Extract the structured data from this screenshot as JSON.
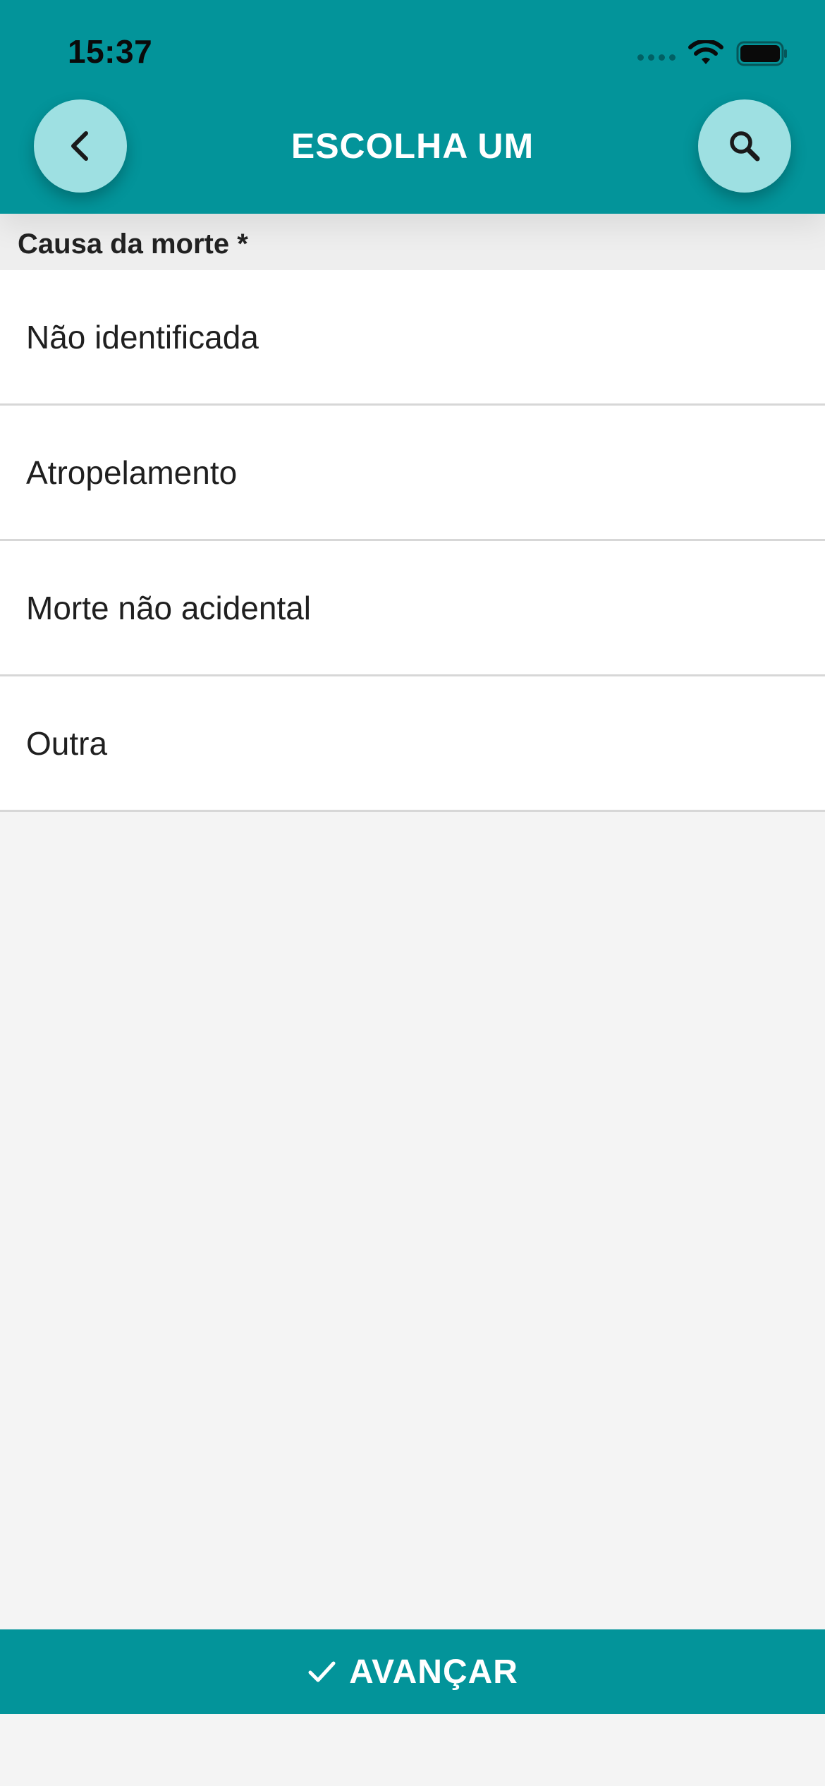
{
  "status_bar": {
    "time": "15:37",
    "icons": [
      "cellular-signal-icon",
      "wifi-icon",
      "battery-icon"
    ]
  },
  "header": {
    "title": "ESCOLHA UM",
    "back_icon": "chevron-left-icon",
    "search_icon": "search-icon"
  },
  "section": {
    "label": "Causa da morte *"
  },
  "options": [
    {
      "label": "Não identificada"
    },
    {
      "label": "Atropelamento"
    },
    {
      "label": "Morte não acidental"
    },
    {
      "label": "Outra"
    }
  ],
  "footer": {
    "label": "AVANÇAR",
    "icon": "check-icon"
  },
  "colors": {
    "primary": "#03949a",
    "button_light": "#9ee0e2",
    "background": "#f4f4f4"
  }
}
